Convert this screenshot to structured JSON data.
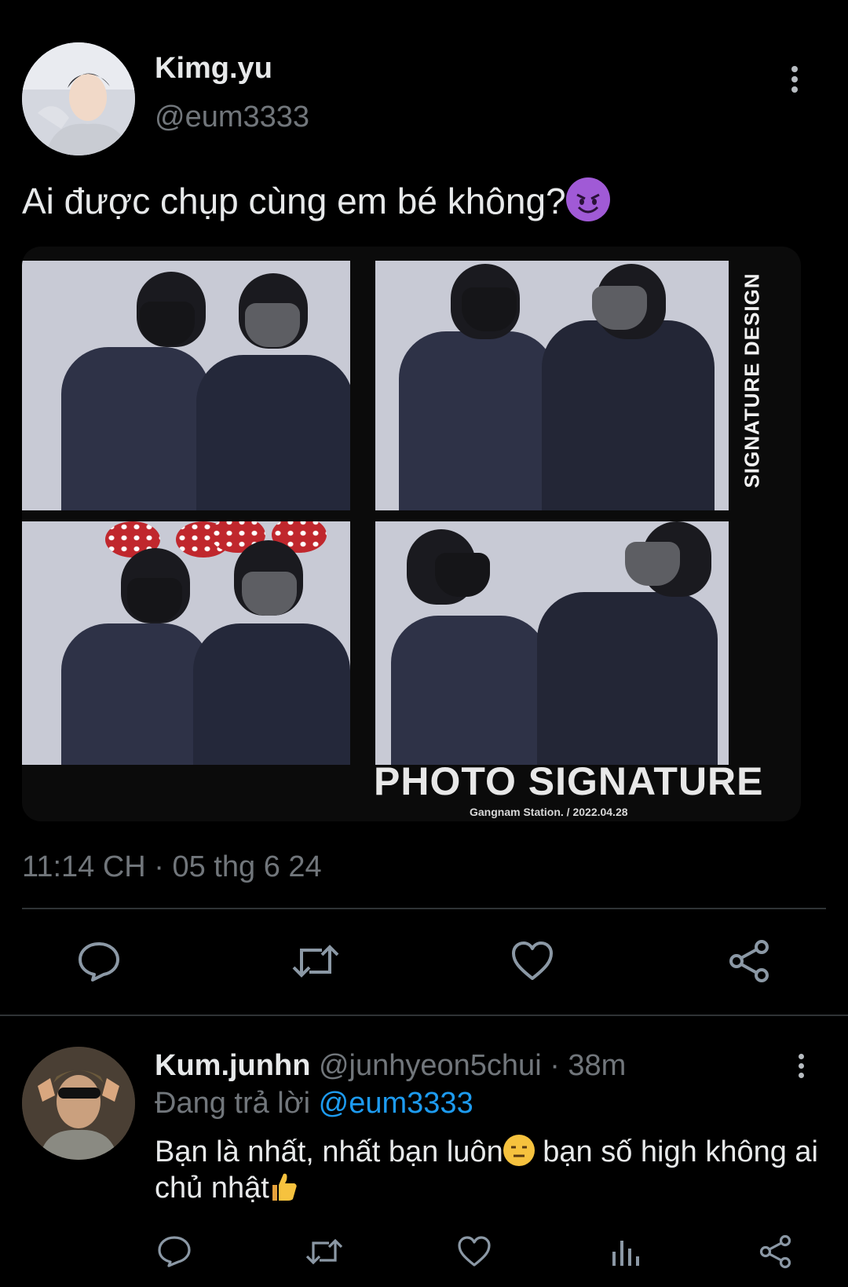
{
  "tweet": {
    "author_name": "Kimg.yu",
    "author_handle": "@eum3333",
    "text": "Ai được chụp cùng em bé không?",
    "emoji": "smiling-devil",
    "photo": {
      "side_text": "SIGNATURE DESIGN",
      "title": "PHOTO SIGNATURE",
      "subtitle": "Gangnam Station.  /  2022.04.28"
    },
    "timestamp": "11:14 CH · 05 thg 6 24"
  },
  "actions": {
    "icons": [
      "reply-icon",
      "retweet-icon",
      "like-icon",
      "share-icon"
    ]
  },
  "reply": {
    "author_name": "Kum.junhn",
    "author_handle": "@junhyeon5chui",
    "time": "· 38m",
    "replying_label": "Đang trả lời",
    "replying_to": "@eum3333",
    "text_part1": "Bạn là nhất, nhất bạn luôn",
    "text_part2": " bạn số high không ai chủ nhật",
    "emojis": [
      "expressionless-face",
      "thumbs-up"
    ],
    "action_icons": [
      "reply-icon",
      "retweet-icon",
      "like-icon",
      "views-icon",
      "share-icon"
    ]
  },
  "colors": {
    "background": "#000000",
    "text": "#e7e9ea",
    "muted": "#71767b",
    "link": "#1d9bf0",
    "divider": "#2f3336"
  }
}
